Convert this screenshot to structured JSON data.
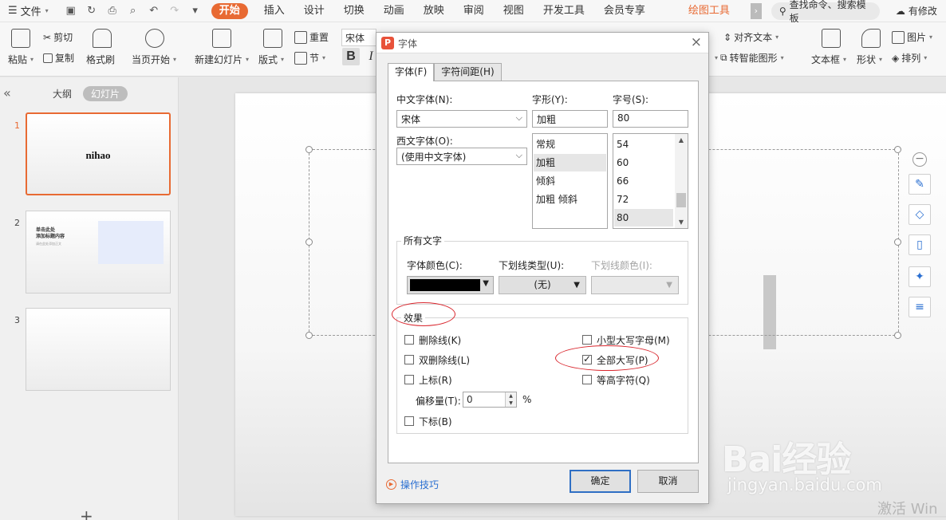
{
  "menubar": {
    "menu_icon": "hamburger-icon",
    "file_label": "文件",
    "tabs": [
      "开始",
      "插入",
      "设计",
      "切换",
      "动画",
      "放映",
      "审阅",
      "视图",
      "开发工具",
      "会员专享"
    ],
    "drawing_tools": "绘图工具",
    "more_glyph": "›",
    "search_placeholder": "查找命令、搜索模板",
    "modify_label": "有修改"
  },
  "ribbon": {
    "paste": "粘贴",
    "cut": "剪切",
    "copy": "复制",
    "format_painter": "格式刷",
    "from_current": "当页开始",
    "new_slide": "新建幻灯片",
    "layout": "版式",
    "reset": "重置",
    "section": "节",
    "font_name": "宋体",
    "bold": "B",
    "italic": "I",
    "align_text": "对齐文本",
    "smartart": "转智能图形",
    "textbox": "文本框",
    "shape": "形状",
    "picture": "图片",
    "arrange": "排列"
  },
  "left_panel": {
    "collapse_glyph": "«",
    "outline_tab": "大纲",
    "slides_tab": "幻灯片",
    "slides": [
      {
        "number": "1",
        "title": "nihao"
      },
      {
        "number": "2",
        "title_line1": "单击此处",
        "title_line2": "添加标题内容",
        "subtitle": "请在此处添加正文"
      },
      {
        "number": "3"
      }
    ],
    "add_glyph": "+"
  },
  "dialog": {
    "app_logo": "P",
    "title": "字体",
    "close_glyph": "×",
    "tabs": [
      "字体(F)",
      "字符间距(H)"
    ],
    "cn_font_label": "中文字体(N):",
    "cn_font_value": "宋体",
    "style_label": "字形(Y):",
    "style_value": "加粗",
    "size_label": "字号(S):",
    "size_value": "80",
    "west_font_label": "西文字体(O):",
    "west_font_value": "(使用中文字体)",
    "styles": [
      "常规",
      "加粗",
      "倾斜",
      "加粗 倾斜"
    ],
    "sizes": [
      "54",
      "60",
      "66",
      "72",
      "80"
    ],
    "all_text_label": "所有文字",
    "font_color_label": "字体颜色(C):",
    "underline_type_label": "下划线类型(U):",
    "underline_type_value": "(无)",
    "underline_color_label": "下划线颜色(I):",
    "font_color": "#000000",
    "effects_label": "效果",
    "strikethrough": "删除线(K)",
    "double_strikethrough": "双删除线(L)",
    "superscript": "上标(R)",
    "offset_label": "偏移量(T):",
    "offset_value": "0",
    "offset_unit": "%",
    "subscript": "下标(B)",
    "small_caps": "小型大写字母(M)",
    "all_caps": "全部大写(P)",
    "equal_height": "等高字符(Q)",
    "tips": "操作技巧",
    "ok": "确定",
    "cancel": "取消"
  },
  "watermark": {
    "brand": "Bai经验",
    "url": "jingyan.baidu.com",
    "activate": "激活 Win"
  },
  "colors": {
    "accent": "#e86a33",
    "annotation": "#d9272e",
    "link": "#2a6fd1"
  }
}
